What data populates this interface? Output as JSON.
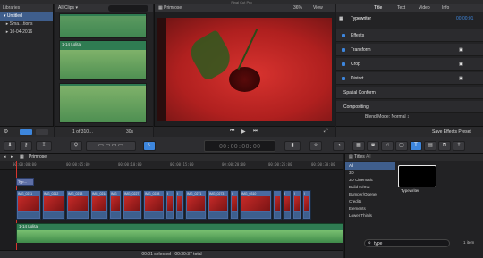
{
  "window": {
    "title": "Final Cut Pro"
  },
  "libraries": {
    "header": "Libraries",
    "items": [
      {
        "label": "Untitled",
        "selected": true
      },
      {
        "label": "Sma…tions",
        "selected": false
      },
      {
        "label": "10-04-2016",
        "selected": false
      }
    ]
  },
  "browser": {
    "filter": "All Clips",
    "clips": [
      {
        "label": ""
      },
      {
        "label": "1-14 Lolita"
      },
      {
        "label": ""
      },
      {
        "label": ""
      }
    ],
    "footer": {
      "count": "1 of 310…",
      "duration": "30s"
    }
  },
  "viewer": {
    "project": "Primrose",
    "zoom": "36%",
    "view": "View"
  },
  "inspector": {
    "tabs": [
      "Title",
      "Text",
      "Video",
      "Info"
    ],
    "name": "Typewriter",
    "timecode": "00:00:01",
    "rows": [
      "Effects",
      "Transform",
      "Crop",
      "Distort",
      "Spatial Conform",
      "Compositing"
    ],
    "blend_label": "Blend Mode:",
    "blend_value": "Normal",
    "save_preset": "Save Effects Preset"
  },
  "toolbar": {
    "timecode": "00:00:00:00",
    "zoom": "100"
  },
  "timeline": {
    "project": "Primrose",
    "ruler": [
      "00:00:00:00",
      "00:00:05:00",
      "00:00:10:00",
      "00:00:15:00",
      "00:00:20:00",
      "00:00:25:00",
      "00:00:30:00"
    ],
    "title_clip": "Typ…",
    "clips": [
      "IMG_0211",
      "IMG_0212",
      "IMG_0213",
      "IMG_0214",
      "IMG",
      "IMG_0227",
      "IMG_0228",
      "I",
      "I",
      "IMG_0271",
      "IMG_0273",
      "I",
      "IMG_0310",
      "I",
      "I",
      "I",
      "I"
    ],
    "music_label": "1-14 Lolita",
    "status": "00:01 selected - 00:30:37 total"
  },
  "titles_browser": {
    "header": "Titles",
    "filter": "All",
    "categories": [
      "All",
      "3D",
      "3D Cinematic",
      "Build In/Out",
      "Bumper/Opener",
      "Credits",
      "Elements",
      "Lower Thirds"
    ],
    "selected_item": "Typewriter",
    "search": "type",
    "count": "1 item"
  }
}
